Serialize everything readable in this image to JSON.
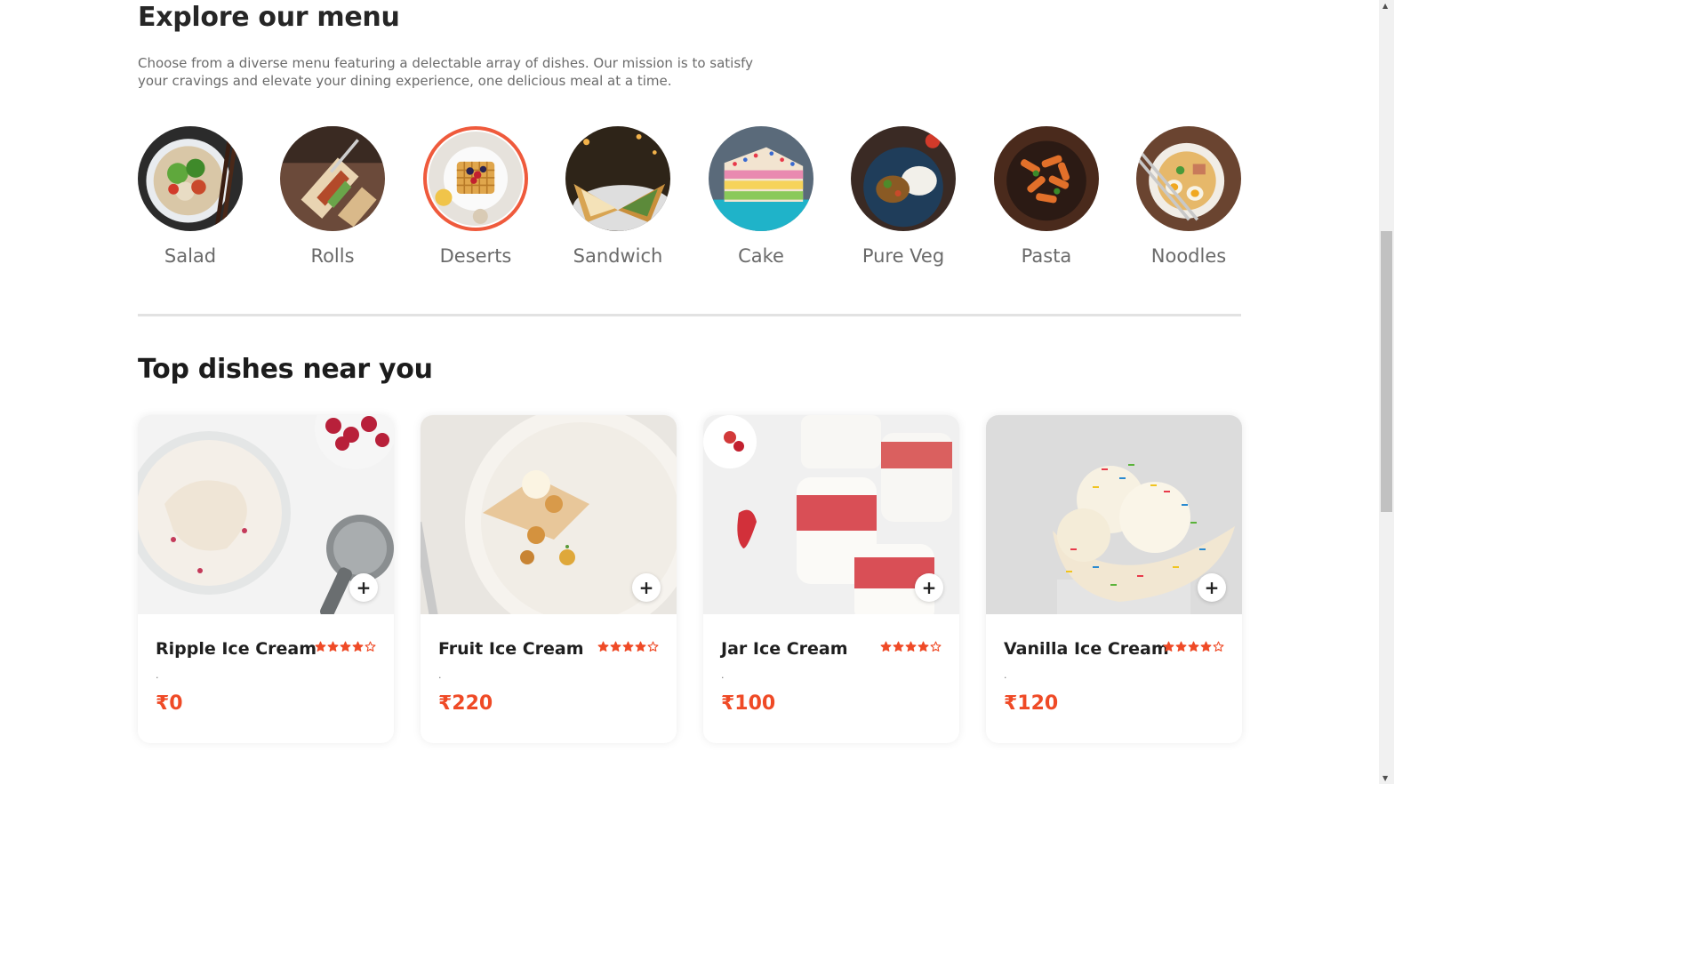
{
  "explore": {
    "title": "Explore our menu",
    "description": "Choose from a diverse menu featuring a delectable array of dishes. Our mission is to satisfy your cravings and elevate your dining experience, one delicious meal at a time."
  },
  "categories": [
    {
      "label": "Salad",
      "icon": "salad-bowl-image",
      "active": false
    },
    {
      "label": "Rolls",
      "icon": "rolls-image",
      "active": false
    },
    {
      "label": "Deserts",
      "icon": "waffle-dessert-image",
      "active": true
    },
    {
      "label": "Sandwich",
      "icon": "sandwich-image",
      "active": false
    },
    {
      "label": "Cake",
      "icon": "cake-image",
      "active": false
    },
    {
      "label": "Pure Veg",
      "icon": "veg-plate-image",
      "active": false
    },
    {
      "label": "Pasta",
      "icon": "pasta-image",
      "active": false
    },
    {
      "label": "Noodles",
      "icon": "noodles-bowl-image",
      "active": false
    }
  ],
  "top_dishes": {
    "title": "Top dishes near you",
    "items": [
      {
        "name": "Ripple Ice Cream",
        "rating": 4,
        "max_rating": 5,
        "description": ".",
        "price": "₹0",
        "add_label": "+",
        "image": "ripple-ice-cream-photo"
      },
      {
        "name": "Fruit Ice Cream",
        "rating": 4,
        "max_rating": 5,
        "description": ".",
        "price": "₹220",
        "add_label": "+",
        "image": "fruit-ice-cream-photo"
      },
      {
        "name": "Jar Ice Cream",
        "rating": 4,
        "max_rating": 5,
        "description": ".",
        "price": "₹100",
        "add_label": "+",
        "image": "jar-ice-cream-photo"
      },
      {
        "name": "Vanilla Ice Cream",
        "rating": 4,
        "max_rating": 5,
        "description": ".",
        "price": "₹120",
        "add_label": "+",
        "image": "vanilla-ice-cream-photo"
      }
    ]
  },
  "colors": {
    "accent": "#ef4a26",
    "active_ring": "#ef5a3c",
    "star": "#ef4a26"
  }
}
